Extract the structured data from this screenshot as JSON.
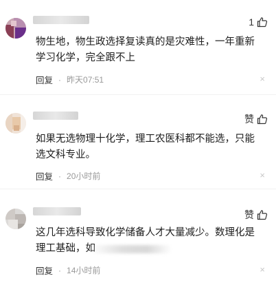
{
  "comments": [
    {
      "like_label": "1",
      "text": "物生地，物生政选择复读真的是灾难性，一年重新学习化学，完全跟不上",
      "reply_label": "回复",
      "time": "昨天07:51",
      "close_label": "×"
    },
    {
      "like_label": "赞",
      "text": "如果无选物理十化学，理工农医科都不能选，只能选文科专业。",
      "reply_label": "回复",
      "time": "20小时前",
      "close_label": "×"
    },
    {
      "like_label": "赞",
      "text": "这几年选科导致化学储备人才大量减少。数理化是理工基础，如",
      "reply_label": "回复",
      "time": "14小时前",
      "close_label": "×"
    }
  ]
}
